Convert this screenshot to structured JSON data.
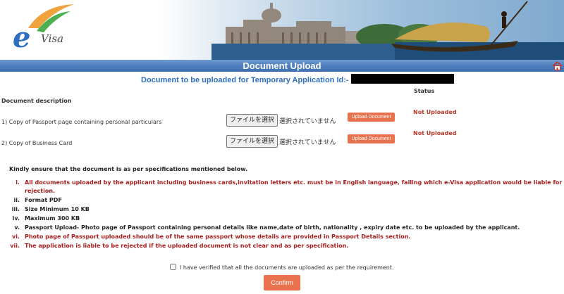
{
  "header": {
    "logo_text": "Visa",
    "logo_letter": "e",
    "page_title": "Document Upload"
  },
  "subtitle": "Document to be uploaded for Temporary Application Id:-",
  "table": {
    "col_description": "Document description",
    "col_status": "Status",
    "rows": [
      {
        "label": "1) Copy of Passport page containing personal particulars",
        "file_button": "ファイルを選択",
        "file_status": "選択されていません",
        "upload_label": "Upload Document",
        "status": "Not Uploaded"
      },
      {
        "label": "2) Copy of Business Card",
        "file_button": "ファイルを選択",
        "file_status": "選択されていません",
        "upload_label": "Upload Document",
        "status": "Not Uploaded"
      }
    ]
  },
  "instructions": {
    "intro": "Kindly ensure that the document is as per specifications mentioned below.",
    "items": [
      {
        "num": "i.",
        "line1": "All documents uploaded by the applicant including business cards,invitation letters etc. must be in English language, failing which e-Visa application would be liable for",
        "line2": "rejection."
      },
      {
        "num": "ii.",
        "line1": "Format PDF"
      },
      {
        "num": "iii.",
        "line1": "Size Minimum 10 KB"
      },
      {
        "num": "iv.",
        "line1": "Maximum 300 KB"
      },
      {
        "num": "v.",
        "line1": "Passport Upload- Photo page of Passport containing personal details like name,date of birth, nationality , expiry date etc. to be uploaded by the applicant."
      },
      {
        "num": "vi.",
        "line1": "Photo page of Passport uploaded should be of the same passport whose details are provided in Passport Details section."
      },
      {
        "num": "vii.",
        "line1": "The application is liable to be rejected if the uploaded document is not clear and as per specification."
      }
    ]
  },
  "verify_label": "I have verified that all the documents are uploaded as per the requirement.",
  "confirm_label": "Confirm",
  "colors": {
    "title_bar": "#4e7fbe",
    "subtitle": "#2e6fbf",
    "button": "#e8724e",
    "warning_red": "#a61d1d",
    "status_red": "#c0392b"
  },
  "icons": {
    "home": "home-icon"
  }
}
